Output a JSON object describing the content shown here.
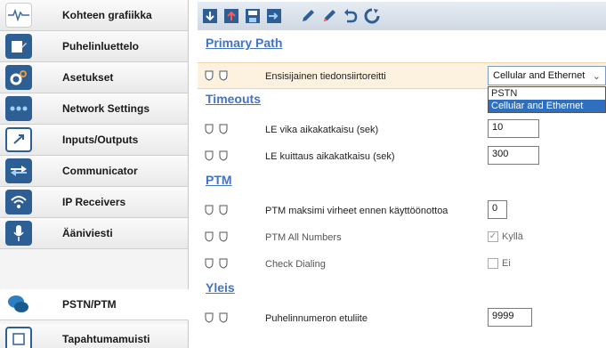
{
  "sidebar": {
    "items": [
      {
        "label": "Kohteen grafiikka",
        "icon": "waveform-icon"
      },
      {
        "label": "Puhelinluettelo",
        "icon": "phonebook-icon"
      },
      {
        "label": "Asetukset",
        "icon": "gear-icon"
      },
      {
        "label": "Network Settings",
        "icon": "network-dots-icon"
      },
      {
        "label": "Inputs/Outputs",
        "icon": "inputs-outputs-icon"
      },
      {
        "label": "Communicator",
        "icon": "communicator-icon"
      },
      {
        "label": "IP Receivers",
        "icon": "wifi-icon"
      },
      {
        "label": "Ääniviesti",
        "icon": "microphone-icon"
      },
      {
        "label": "PSTN/PTM",
        "icon": "chat-icon"
      },
      {
        "label": "Tapahtumamuisti",
        "icon": "event-log-icon"
      }
    ],
    "active_index": 8
  },
  "toolbar": {
    "buttons": [
      "read-icon",
      "write-icon",
      "save-icon",
      "import-icon",
      "edit-icon",
      "edit-alt-icon",
      "undo-icon",
      "refresh-icon"
    ]
  },
  "sections": {
    "primary_path": "Primary Path",
    "timeouts": "Timeouts",
    "ptm": "PTM",
    "yleis": "Yleis"
  },
  "fields": {
    "primary_path_label": "Ensisijainen tiedonsiirtoreitti",
    "primary_path_value": "Cellular and Ethernet",
    "primary_path_options": [
      "PSTN",
      "Cellular and Ethernet"
    ],
    "le_fault_label": "LE vika aikakatkaisu (sek)",
    "le_fault_value": "10",
    "le_ack_label": "LE kuittaus aikakatkaisu (sek)",
    "le_ack_value": "300",
    "ptm_max_label": "PTM maksimi virheet ennen käyttöönottoa",
    "ptm_max_value": "0",
    "ptm_all_label": "PTM All Numbers",
    "ptm_all_value": "Kyllä",
    "check_dialing_label": "Check Dialing",
    "check_dialing_value": "Ei",
    "phone_prefix_label": "Puhelinnumeron etuliite",
    "phone_prefix_value": "9999"
  },
  "colors": {
    "section_title": "#4472c4",
    "highlight_row": "#fdf1df",
    "selected_option": "#2f6fbf"
  }
}
